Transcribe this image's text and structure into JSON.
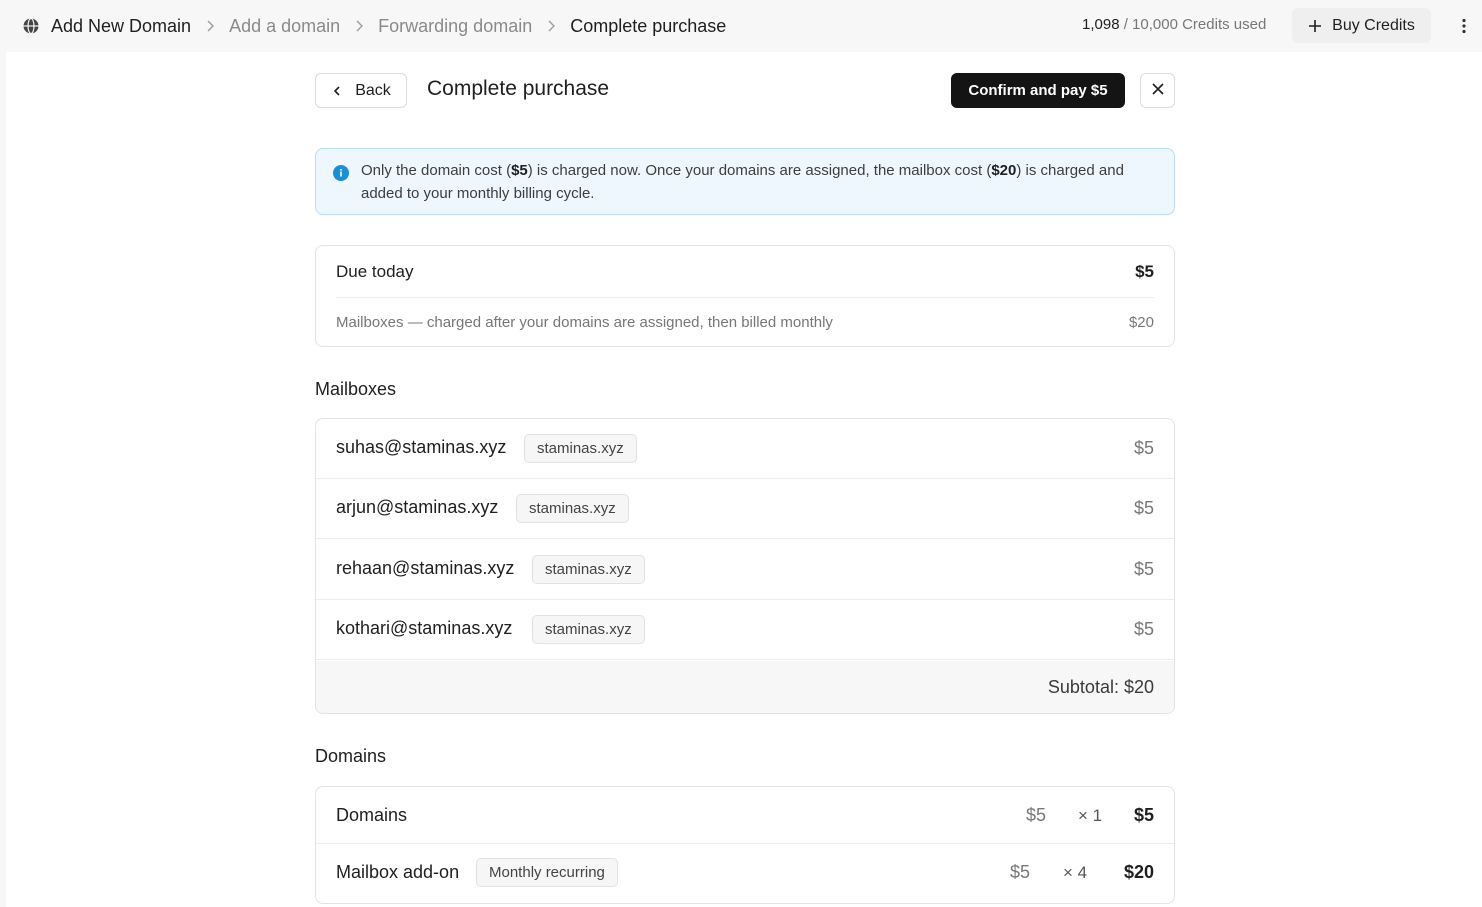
{
  "breadcrumb": {
    "items": [
      "Add New Domain",
      "Add a domain",
      "Forwarding domain",
      "Complete purchase"
    ]
  },
  "credits": {
    "used": "1,098",
    "total": "/ 10,000 Credits used"
  },
  "buy_credits_label": "Buy Credits",
  "header": {
    "back_label": "Back",
    "title": "Complete purchase",
    "confirm_label": "Confirm and pay $5"
  },
  "notice": {
    "part1": "Only the domain cost (",
    "domain_cost": "$5",
    "part2": ") is charged now. Once your domains are assigned, the mailbox cost (",
    "mailbox_cost": "$20",
    "part3": ") is charged and added to your monthly billing cycle."
  },
  "due": {
    "label": "Due today",
    "amount": "$5",
    "mailboxes_note": "Mailboxes — charged after your domains are assigned, then billed monthly",
    "mailboxes_amount": "$20"
  },
  "mailboxes": {
    "title": "Mailboxes",
    "items": [
      {
        "email": "suhas@staminas.xyz",
        "domain": "staminas.xyz",
        "price": "$5"
      },
      {
        "email": "arjun@staminas.xyz",
        "domain": "staminas.xyz",
        "price": "$5"
      },
      {
        "email": "rehaan@staminas.xyz",
        "domain": "staminas.xyz",
        "price": "$5"
      },
      {
        "email": "kothari@staminas.xyz",
        "domain": "staminas.xyz",
        "price": "$5"
      }
    ],
    "subtotal": "Subtotal: $20"
  },
  "domains": {
    "title": "Domains",
    "rows": [
      {
        "name": "Domains",
        "tag": "",
        "unit": "$5",
        "qty": "× 1",
        "total": "$5"
      },
      {
        "name": "Mailbox add-on",
        "tag": "Monthly recurring",
        "unit": "$5",
        "qty": "× 4",
        "total": "$20"
      }
    ]
  },
  "colors": {
    "primary_button": "#141414",
    "notice_bg": "#eef7fd",
    "notice_border": "#b9dcf2",
    "info_icon": "#1a8fd6"
  }
}
